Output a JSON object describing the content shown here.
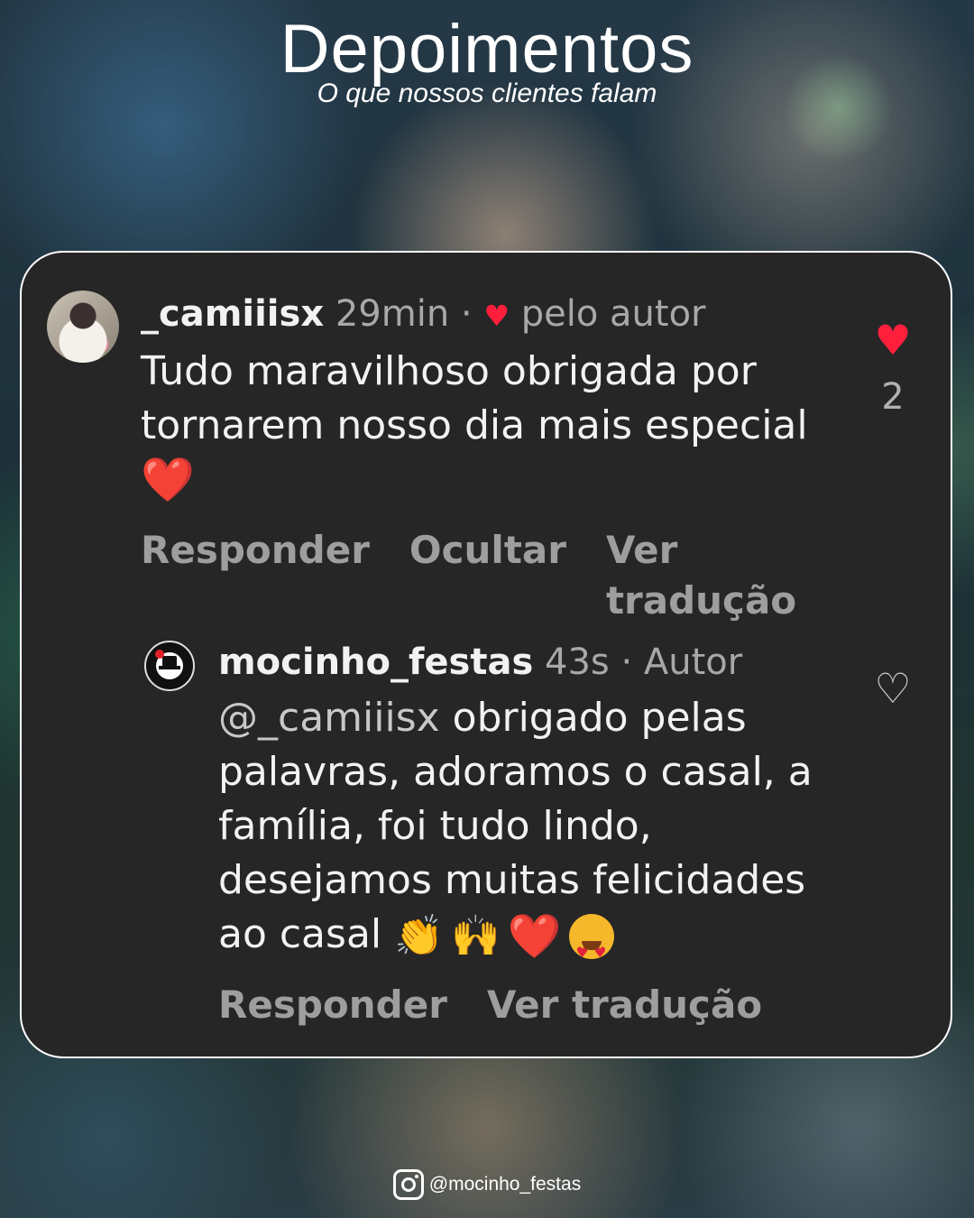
{
  "header": {
    "title": "Depoimentos",
    "subtitle": "O que nossos clientes falam"
  },
  "comment": {
    "username": "_camiiisx",
    "time": "29min",
    "separator": "·",
    "liked_by_label": "pelo autor",
    "text": "Tudo maravilhoso obrigada por tornarem nosso dia mais especial",
    "emoji": "❤️",
    "like_count": "2",
    "actions": [
      "Responder",
      "Ocultar",
      "Ver tradução"
    ]
  },
  "reply": {
    "username": "mocinho_festas",
    "time": "43s",
    "role_label": "· Autor",
    "mention": "@_camiiisx",
    "text": " obrigado pelas palavras, adoramos o casal, a família, foi tudo lindo, desejamos muitas felicidades ao casal",
    "emojis": [
      "👏",
      "🙌",
      "❤️",
      "😍"
    ],
    "actions": [
      "Responder",
      "Ver tradução"
    ]
  },
  "footer": {
    "handle": "@mocinho_festas",
    "icon": "instagram-icon"
  },
  "colors": {
    "card_bg": "#262626",
    "like_red": "#ff1f3d",
    "muted": "#a8a8a8"
  }
}
